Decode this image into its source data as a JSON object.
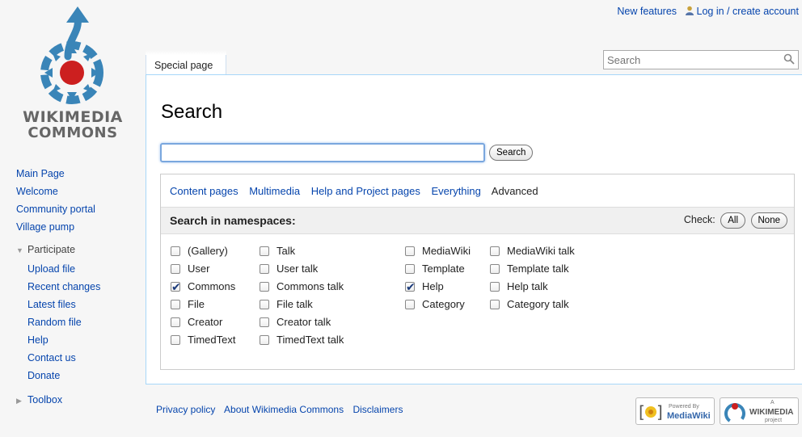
{
  "personal": {
    "new_features": "New features",
    "login": "Log in / create account"
  },
  "logo": {
    "line1": "WIKIMEDIA",
    "line2": "COMMONS"
  },
  "sidebar": {
    "main": [
      {
        "label": "Main Page"
      },
      {
        "label": "Welcome"
      },
      {
        "label": "Community portal"
      },
      {
        "label": "Village pump"
      }
    ],
    "participate_heading": "Participate",
    "participate": [
      {
        "label": "Upload file"
      },
      {
        "label": "Recent changes"
      },
      {
        "label": "Latest files"
      },
      {
        "label": "Random file"
      },
      {
        "label": "Help"
      },
      {
        "label": "Contact us"
      },
      {
        "label": "Donate"
      }
    ],
    "toolbox_heading": "Toolbox"
  },
  "tab": {
    "label": "Special page"
  },
  "top_search": {
    "placeholder": "Search"
  },
  "page": {
    "title": "Search",
    "search_value": "",
    "search_button": "Search"
  },
  "profiles": {
    "items": [
      "Content pages",
      "Multimedia",
      "Help and Project pages",
      "Everything"
    ],
    "current": "Advanced"
  },
  "namespaces": {
    "title": "Search in namespaces:",
    "check_label": "Check:",
    "all": "All",
    "none": "None",
    "columns": [
      [
        {
          "label": "(Gallery)",
          "checked": false
        },
        {
          "label": "User",
          "checked": false
        },
        {
          "label": "Commons",
          "checked": true
        },
        {
          "label": "File",
          "checked": false
        },
        {
          "label": "Creator",
          "checked": false
        },
        {
          "label": "TimedText",
          "checked": false
        }
      ],
      [
        {
          "label": "Talk",
          "checked": false
        },
        {
          "label": "User talk",
          "checked": false
        },
        {
          "label": "Commons talk",
          "checked": false
        },
        {
          "label": "File talk",
          "checked": false
        },
        {
          "label": "Creator talk",
          "checked": false
        },
        {
          "label": "TimedText talk",
          "checked": false
        }
      ],
      [
        {
          "label": "MediaWiki",
          "checked": false
        },
        {
          "label": "Template",
          "checked": false
        },
        {
          "label": "Help",
          "checked": true
        },
        {
          "label": "Category",
          "checked": false
        }
      ],
      [
        {
          "label": "MediaWiki talk",
          "checked": false
        },
        {
          "label": "Template talk",
          "checked": false
        },
        {
          "label": "Help talk",
          "checked": false
        },
        {
          "label": "Category talk",
          "checked": false
        }
      ]
    ]
  },
  "footer": {
    "links": [
      "Privacy policy",
      "About Wikimedia Commons",
      "Disclaimers"
    ],
    "badge_mw_small": "Powered By",
    "badge_mw_big": "MediaWiki",
    "badge_wm_small_top": "A",
    "badge_wm_big": "WIKIMEDIA",
    "badge_wm_small_bottom": "project"
  },
  "colors": {
    "link": "#0645ad",
    "commons_blue": "#3a85b8",
    "commons_red": "#cc1f1f"
  }
}
